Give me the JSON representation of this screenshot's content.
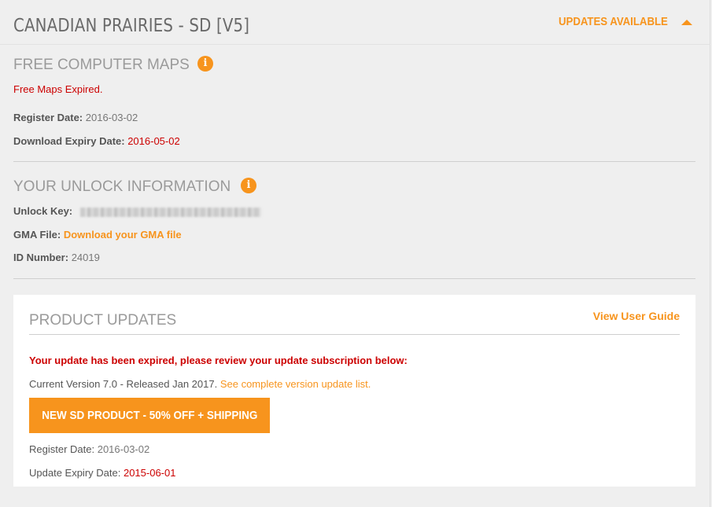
{
  "header": {
    "title": "CANADIAN PRAIRIES - SD [V5]",
    "updates_label": "UPDATES AVAILABLE"
  },
  "free_maps": {
    "title": "FREE COMPUTER MAPS",
    "status": "Free Maps Expired.",
    "register_label": "Register Date:",
    "register_value": "2016-03-02",
    "expiry_label": "Download Expiry Date:",
    "expiry_value": "2016-05-02"
  },
  "unlock": {
    "title": "YOUR UNLOCK INFORMATION",
    "key_label": "Unlock Key:",
    "gma_label": "GMA File:",
    "gma_link": "Download your GMA file",
    "id_label": "ID Number:",
    "id_value": "24019"
  },
  "product_updates": {
    "title": "PRODUCT UPDATES",
    "guide_link": "View User Guide",
    "expired_msg": "Your update has been expired, please review your update subscription below:",
    "current_version": "Current Version 7.0 - Released Jan 2017.",
    "version_link": "See complete version update list.",
    "cta_label": "NEW SD PRODUCT - 50% OFF + SHIPPING",
    "register_label": "Register Date:",
    "register_value": "2016-03-02",
    "expiry_label": "Update Expiry Date:",
    "expiry_value": "2015-06-01"
  },
  "icons": {
    "info": "info-icon",
    "caret": "caret-up-icon"
  },
  "colors": {
    "accent": "#f7941d",
    "alert": "#cc0000",
    "background": "#efefef"
  }
}
